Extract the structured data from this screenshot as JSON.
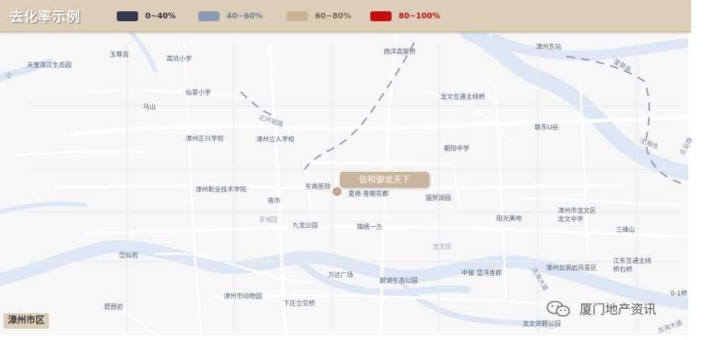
{
  "legend": {
    "title": "去化率示例",
    "ranges": [
      {
        "label": "0~40%",
        "swatch_color": "#353a52",
        "label_color": "#2b2f45"
      },
      {
        "label": "40~60%",
        "swatch_color": "#8a9bb4",
        "label_color": "#6f7f99"
      },
      {
        "label": "60~80%",
        "swatch_color": "#c8b292",
        "label_color": "#7a6448"
      },
      {
        "label": "80~100%",
        "swatch_color": "#c40d0d",
        "label_color": "#c40d0d"
      }
    ]
  },
  "map": {
    "callout_label": "信和御龙天下",
    "city_label": "漳州市区",
    "watermark": "厦门地产资讯",
    "watermark_icon": "wechat-icon",
    "pois": [
      "天宝滨江生态园",
      "玉尊宫",
      "高坑小学",
      "西洋高架桥",
      "漳州东站",
      "仙景小学",
      "龙文互通主线桥",
      "马山",
      "漳州正兴学校",
      "漳州立人学校",
      "联东U谷",
      "朝阳中学",
      "东南医院",
      "夏商·香榭花都",
      "漳州职业技术学院",
      "夜市",
      "国贸润园",
      "阳光美地",
      "漳州市龙文区龙文中学",
      "九龙公园",
      "锦绣一方",
      "三峰山",
      "岱仙岩",
      "万达广场",
      "碧湖生态公园",
      "中骏·蓝湾香郡",
      "漳州云洞岩风景区",
      "江东互通主线桥右桥",
      "漳州市动物园",
      "下庄立交桥",
      "琵琶岩",
      "龙文郊野公园",
      "0-1桥"
    ],
    "districts": [
      "芗城区",
      "龙文区"
    ],
    "roads": [
      "北环城路",
      "厦蓉高",
      "沈海线",
      "沈海大道",
      "龙海大道",
      "企业路",
      "兴"
    ]
  },
  "colors": {
    "legend_bg": "#dccdb8",
    "callout_bg": "#c9b59c",
    "river": "#dfe8f5",
    "road": "#ffffff",
    "land": "#f7f7f8"
  }
}
